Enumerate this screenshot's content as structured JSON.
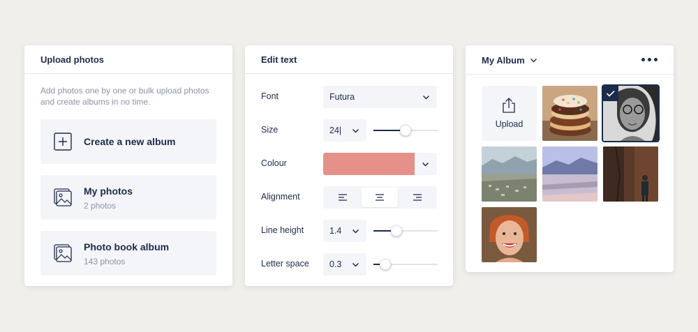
{
  "upload_card": {
    "title": "Upload photos",
    "description": "Add photos one by one or bulk upload photos and create albums in no time.",
    "tiles": [
      {
        "title": "Create a new album",
        "subtitle": ""
      },
      {
        "title": "My photos",
        "subtitle": "2 photos"
      },
      {
        "title": "Photo book album",
        "subtitle": "143 photos"
      }
    ]
  },
  "edit_card": {
    "title": "Edit text",
    "font": {
      "label": "Font",
      "value": "Futura"
    },
    "size": {
      "label": "Size",
      "value": "24|",
      "level": 0.5
    },
    "colour": {
      "label": "Colour",
      "value": "#e6908a"
    },
    "alignment": {
      "label": "Alignment",
      "options": [
        "left",
        "center",
        "right"
      ],
      "selected": "center"
    },
    "line_height": {
      "label": "Line height",
      "value": "1.4",
      "level": 0.36
    },
    "letter_space": {
      "label": "Letter space",
      "value": "0.3",
      "level": 0.18
    }
  },
  "album_card": {
    "title": "My Album",
    "upload_label": "Upload",
    "photos": [
      {
        "name": "donuts-photo",
        "selected": false
      },
      {
        "name": "woman-glasses-photo",
        "selected": true
      },
      {
        "name": "mountain-town-photo",
        "selected": false
      },
      {
        "name": "lake-valley-photo",
        "selected": false
      },
      {
        "name": "man-rust-wall-photo",
        "selected": false
      },
      {
        "name": "smiling-woman-photo",
        "selected": false
      }
    ]
  },
  "colors": {
    "accent": "#1c2b4a",
    "tile_bg": "#f3f5f9",
    "page_bg": "#f0efec"
  }
}
